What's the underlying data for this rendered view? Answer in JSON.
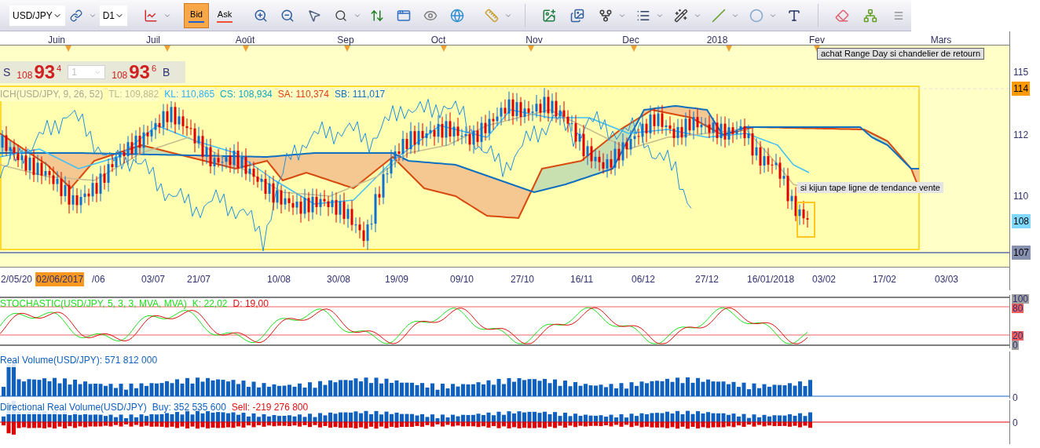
{
  "toolbar": {
    "symbol": "USD/JPY",
    "timeframe": "D1",
    "price_modes": [
      {
        "label": "Bid",
        "selected": true
      },
      {
        "label": "Ask",
        "selected": false
      }
    ]
  },
  "months": [
    "Juin",
    "Juil",
    "Août",
    "Sep",
    "Oct",
    "Nov",
    "Dec",
    "2018",
    "Fev",
    "Mars"
  ],
  "quote": {
    "sell": {
      "label": "S",
      "big": "108",
      "pips": "93",
      "frac": "4"
    },
    "volume": "1",
    "buy": {
      "label": "B",
      "big": "108",
      "pips": "93",
      "frac": "6"
    }
  },
  "ichimoku": {
    "name": "ICH(USD/JPY, 9, 26, 52)",
    "values": [
      {
        "label": "TL: 109,882",
        "color": "#c0b888"
      },
      {
        "label": "KL: 110,865",
        "color": "#30b0f0"
      },
      {
        "label": "CS: 108,934",
        "color": "#10a8b8"
      },
      {
        "label": "SA: 110,374",
        "color": "#e04010"
      },
      {
        "label": "SB: 111,017",
        "color": "#1070c0"
      }
    ]
  },
  "notes": [
    "achat Range Day si chandelier de retourn",
    "si kijun tape ligne de tendance vente"
  ],
  "price_axis": [
    {
      "label": "115",
      "kind": "tick"
    },
    {
      "label": "114",
      "kind": "flag",
      "color": "#ff9900"
    },
    {
      "label": "112",
      "kind": "tick"
    },
    {
      "label": "110",
      "kind": "tick"
    },
    {
      "label": "108",
      "kind": "flag",
      "color": "#80d8ff"
    },
    {
      "label": "107",
      "kind": "flag",
      "color": "#8890b0"
    }
  ],
  "dates": [
    {
      "label": "2/05/20",
      "selected": false
    },
    {
      "label": "02/06/2017",
      "selected": true
    },
    {
      "label": "/06",
      "selected": false
    },
    {
      "label": "03/07",
      "selected": false
    },
    {
      "label": "21/07",
      "selected": false
    },
    {
      "label": "10/08",
      "selected": false
    },
    {
      "label": "30/08",
      "selected": false
    },
    {
      "label": "19/09",
      "selected": false
    },
    {
      "label": "09/10",
      "selected": false
    },
    {
      "label": "27/10",
      "selected": false
    },
    {
      "label": "16/11",
      "selected": false
    },
    {
      "label": "06/12",
      "selected": false
    },
    {
      "label": "27/12",
      "selected": false
    },
    {
      "label": "16/01/2018",
      "selected": false
    },
    {
      "label": "03/02",
      "selected": false
    },
    {
      "label": "17/02",
      "selected": false
    },
    {
      "label": "03/03",
      "selected": false
    }
  ],
  "stochastic": {
    "name": "STOCHASTIC(USD/JPY, 5, 3, 3, MVA, MVA)",
    "k": "K: 22,02",
    "d": "D: 19,00",
    "axis": [
      {
        "label": "100",
        "color": "#a0a0a0"
      },
      {
        "label": "80",
        "color": "#f06060"
      },
      {
        "label": "20",
        "color": "#f06060"
      },
      {
        "label": "0",
        "color": "#a0a0a0"
      }
    ]
  },
  "real_volume": {
    "name": "Real Volume(USD/JPY): 571 812 000",
    "axis": [
      "0"
    ]
  },
  "directional_volume": {
    "name": "Directional Real Volume(USD/JPY)",
    "buy": "Buy: 352 535 600",
    "sell": "Sell: -219 276 800",
    "axis": [
      "0"
    ]
  }
}
